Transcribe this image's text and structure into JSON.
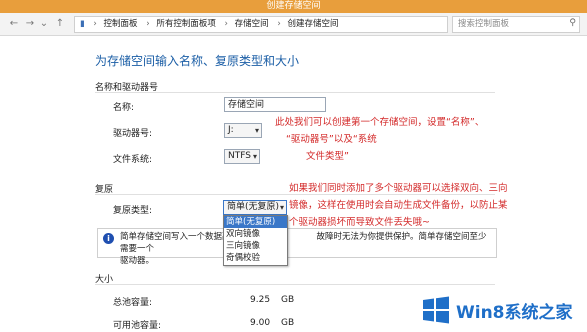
{
  "window": {
    "title": "创建存储空间"
  },
  "address_bar": {
    "breadcrumbs": [
      "控制面板",
      "所有控制面板项",
      "存储空间",
      "创建存储空间"
    ],
    "search_placeholder": "搜索控制面板"
  },
  "page": {
    "heading": "为存储空间输入名称、复原类型和大小"
  },
  "name_drive_section": {
    "title": "名称和驱动器号",
    "name_label": "名称:",
    "name_value": "存储空间",
    "drive_label": "驱动器号:",
    "drive_value": "J:",
    "fs_label": "文件系统:",
    "fs_value": "NTFS"
  },
  "resiliency_section": {
    "title": "复原",
    "type_label": "复原类型:",
    "type_value": "简单(无复原)",
    "options": [
      "简单(无复原)",
      "双向镜像",
      "三向镜像",
      "奇偶校验"
    ],
    "selected_index": 0,
    "info_text_left": "简单存储空间写入一个数据副",
    "info_text_right": "故障时无法为你提供保护。简单存储空间至少需要一个",
    "info_text_line2": "驱动器。"
  },
  "size_section": {
    "title": "大小",
    "total_label": "总池容量:",
    "total_value": "9.25",
    "total_unit": "GB",
    "available_label": "可用池容量:",
    "available_value": "9.00",
    "available_unit": "GB"
  },
  "annotations": {
    "note1_line1": "此处我们可以创建第一个存储空间，设置“名称”、",
    "note1_line2": "“驱动器号”以及“系统",
    "note1_line3": "文件类型”",
    "note2_line1": "如果我们同时添加了多个驱动器可以选择双向、三向",
    "note2_line2": "镜像，这样在使用时会自动生成文件备份，以防止某",
    "note2_line3": "个驱动器损坏而导致文件丢失哦~"
  },
  "watermark": {
    "text": "Win8系统之家"
  },
  "colors": {
    "titlebar": "#e89e3c",
    "heading": "#1b5ea6",
    "annotation": "#d32a2a",
    "selection": "#3a77c8"
  }
}
